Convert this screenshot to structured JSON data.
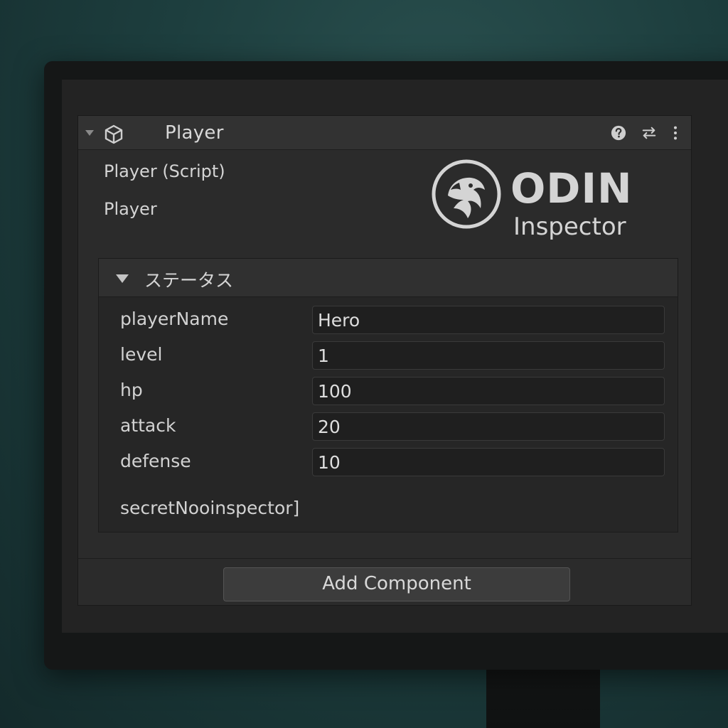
{
  "component": {
    "title": "Player",
    "script_label": "Player (Script)",
    "script_value": "Player",
    "icons": [
      "cube-icon",
      "help-icon",
      "preset-icon",
      "menu-icon"
    ]
  },
  "logo": {
    "title": "ODIN",
    "subtitle": "Inspector"
  },
  "group": {
    "title": "ステータス",
    "fields": [
      {
        "label": "playerName",
        "value": "Hero"
      },
      {
        "label": "level",
        "value": "1"
      },
      {
        "label": "hp",
        "value": "100"
      },
      {
        "label": "attack",
        "value": "20"
      },
      {
        "label": "defense",
        "value": "10"
      }
    ],
    "hidden_field_note": "secretNooinspector]"
  },
  "add_component_label": "Add Component",
  "colors": {
    "background": "#1d3e3e",
    "panel": "#2b2b2b",
    "header": "#323232",
    "input": "#1f1f1f",
    "text": "#d4d4d4"
  }
}
